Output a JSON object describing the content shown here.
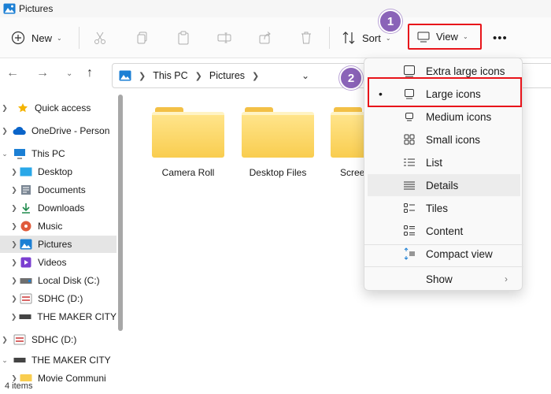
{
  "window": {
    "title": "Pictures"
  },
  "toolbar": {
    "new_label": "New",
    "sort_label": "Sort",
    "view_label": "View",
    "more_label": "•••"
  },
  "badges": {
    "one": "1",
    "two": "2"
  },
  "address": {
    "crumbs": [
      "This PC",
      "Pictures"
    ]
  },
  "sidebar": {
    "items": [
      {
        "label": "Quick access",
        "icon": "star-icon"
      },
      {
        "label": "OneDrive - Person",
        "icon": "cloud-icon"
      },
      {
        "label": "This PC",
        "icon": "computer-icon"
      },
      {
        "label": "Desktop",
        "icon": "desktop-icon"
      },
      {
        "label": "Documents",
        "icon": "documents-icon"
      },
      {
        "label": "Downloads",
        "icon": "download-icon"
      },
      {
        "label": "Music",
        "icon": "music-icon"
      },
      {
        "label": "Pictures",
        "icon": "pictures-icon"
      },
      {
        "label": "Videos",
        "icon": "videos-icon"
      },
      {
        "label": "Local Disk (C:)",
        "icon": "disk-icon"
      },
      {
        "label": "SDHC (D:)",
        "icon": "sd-card-icon"
      },
      {
        "label": "THE MAKER CITY",
        "icon": "drive-icon"
      },
      {
        "label": "SDHC (D:)",
        "icon": "sd-card-icon"
      },
      {
        "label": "THE MAKER CITY",
        "icon": "drive-icon"
      },
      {
        "label": "Movie Communi",
        "icon": "folder-icon"
      }
    ]
  },
  "files": [
    {
      "name": "Camera Roll"
    },
    {
      "name": "Desktop Files"
    },
    {
      "name": "Scree"
    }
  ],
  "status": {
    "count": "4 items"
  },
  "view_menu": {
    "items": [
      {
        "label": "Extra large icons"
      },
      {
        "label": "Large icons",
        "selected_marker": "•"
      },
      {
        "label": "Medium icons"
      },
      {
        "label": "Small icons"
      },
      {
        "label": "List"
      },
      {
        "label": "Details"
      },
      {
        "label": "Tiles"
      },
      {
        "label": "Content"
      },
      {
        "label": "Compact view"
      },
      {
        "label": "Show",
        "arrow": "›"
      }
    ]
  },
  "colors": {
    "highlight": "#e8141a",
    "badge": "#8a63b8",
    "folder": "#f9cd4f"
  }
}
